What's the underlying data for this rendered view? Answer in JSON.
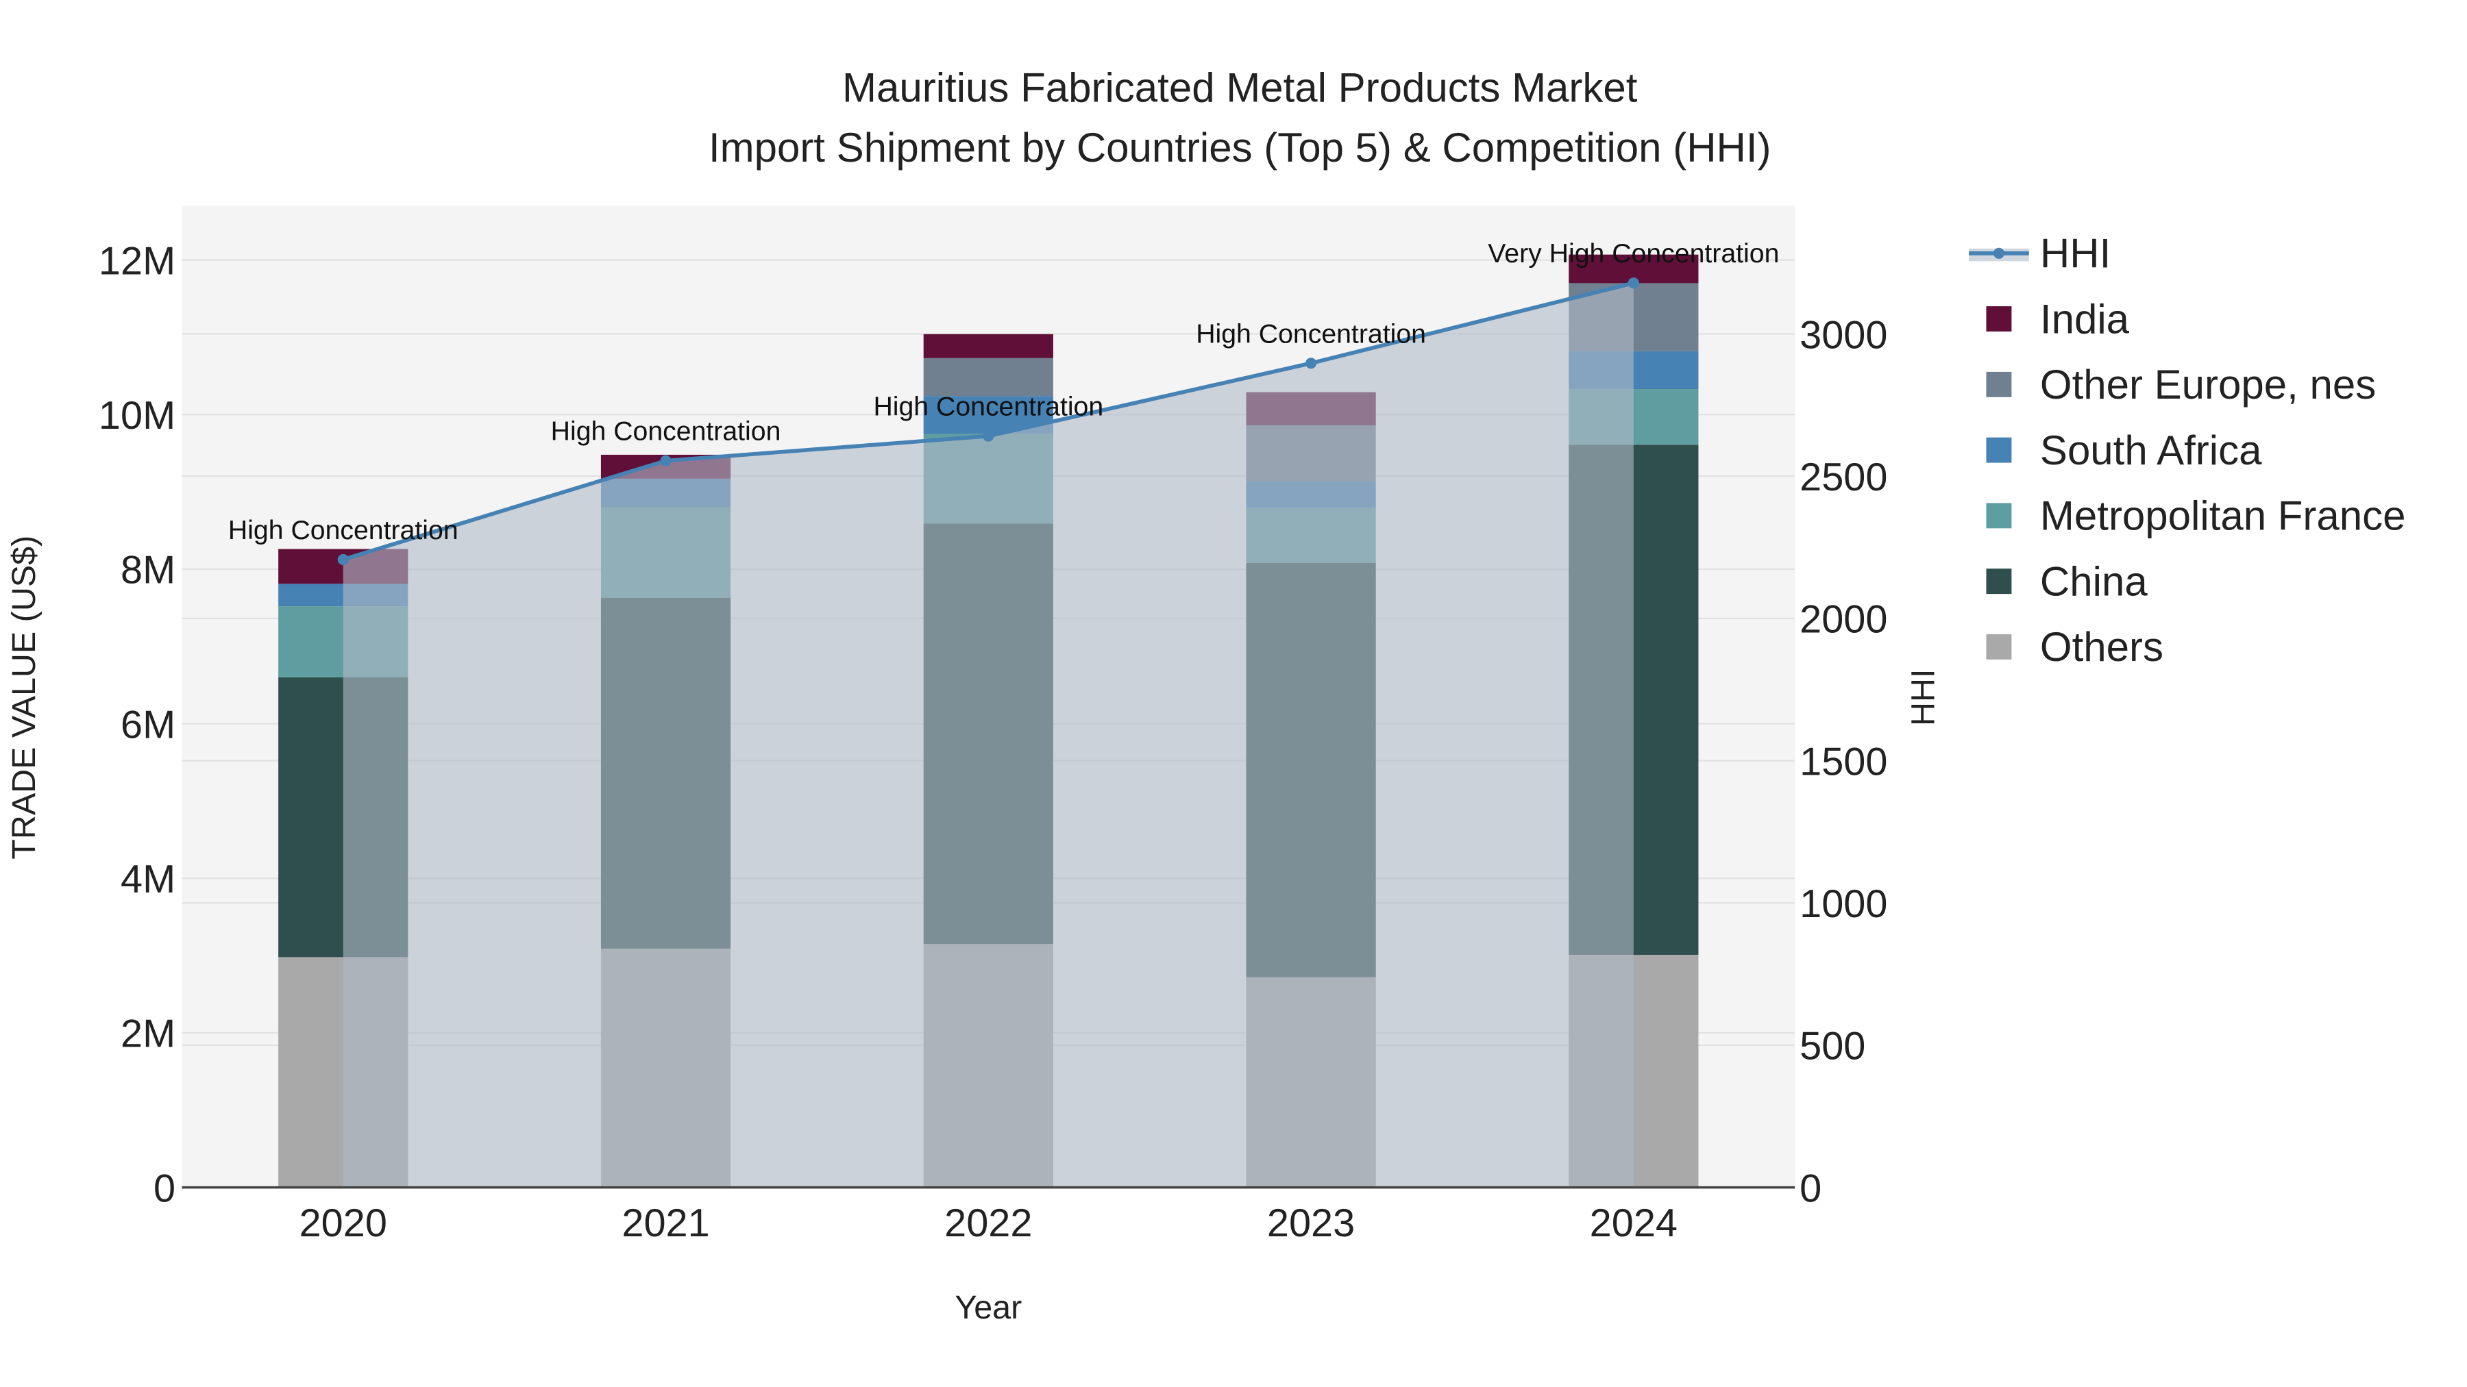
{
  "chart_data": {
    "type": "bar",
    "title": "Mauritius Fabricated Metal Products Market",
    "subtitle": "Import Shipment by Countries (Top 5) & Competition (HHI)",
    "xlabel": "Year",
    "ylabel": "TRADE VALUE (US$)",
    "y2label": "HHI",
    "categories": [
      "2020",
      "2021",
      "2022",
      "2023",
      "2024"
    ],
    "ylim": [
      0,
      12700000
    ],
    "y2lim": [
      0,
      3450
    ],
    "yticks": [
      0,
      2000000,
      4000000,
      6000000,
      8000000,
      10000000,
      12000000
    ],
    "ytick_labels": [
      "0",
      "2M",
      "4M",
      "6M",
      "8M",
      "10M",
      "12M"
    ],
    "y2ticks": [
      0,
      500,
      1000,
      1500,
      2000,
      2500,
      3000
    ],
    "y2tick_labels": [
      "0",
      "500",
      "1000",
      "1500",
      "2000",
      "2500",
      "3000"
    ],
    "series": [
      {
        "name": "Others",
        "color": "#a9a9a9",
        "values": [
          2980000,
          3090000,
          3150000,
          2720000,
          3010000
        ]
      },
      {
        "name": "China",
        "color": "#2f4f4f",
        "values": [
          3620000,
          4540000,
          5440000,
          5360000,
          6600000
        ]
      },
      {
        "name": "Metropolitan France",
        "color": "#5f9ea0",
        "values": [
          920000,
          1170000,
          1160000,
          710000,
          720000
        ]
      },
      {
        "name": "South Africa",
        "color": "#4682b4",
        "values": [
          290000,
          370000,
          490000,
          350000,
          490000
        ]
      },
      {
        "name": "Other Europe, nes",
        "color": "#708090",
        "values": [
          0,
          0,
          490000,
          720000,
          880000
        ]
      },
      {
        "name": "India",
        "color": "#601038",
        "values": [
          450000,
          310000,
          310000,
          430000,
          370000
        ]
      }
    ],
    "line": {
      "name": "HHI",
      "color": "#4682b4",
      "values": [
        2207,
        2554,
        2641,
        2897,
        3179
      ],
      "annotations": [
        "High Concentration",
        "High Concentration",
        "High Concentration",
        "High Concentration",
        "Very High Concentration"
      ]
    },
    "legend_order": [
      "HHI",
      "India",
      "Other Europe, nes",
      "South Africa",
      "Metropolitan France",
      "China",
      "Others"
    ],
    "legend_position": "right",
    "grid": true
  }
}
